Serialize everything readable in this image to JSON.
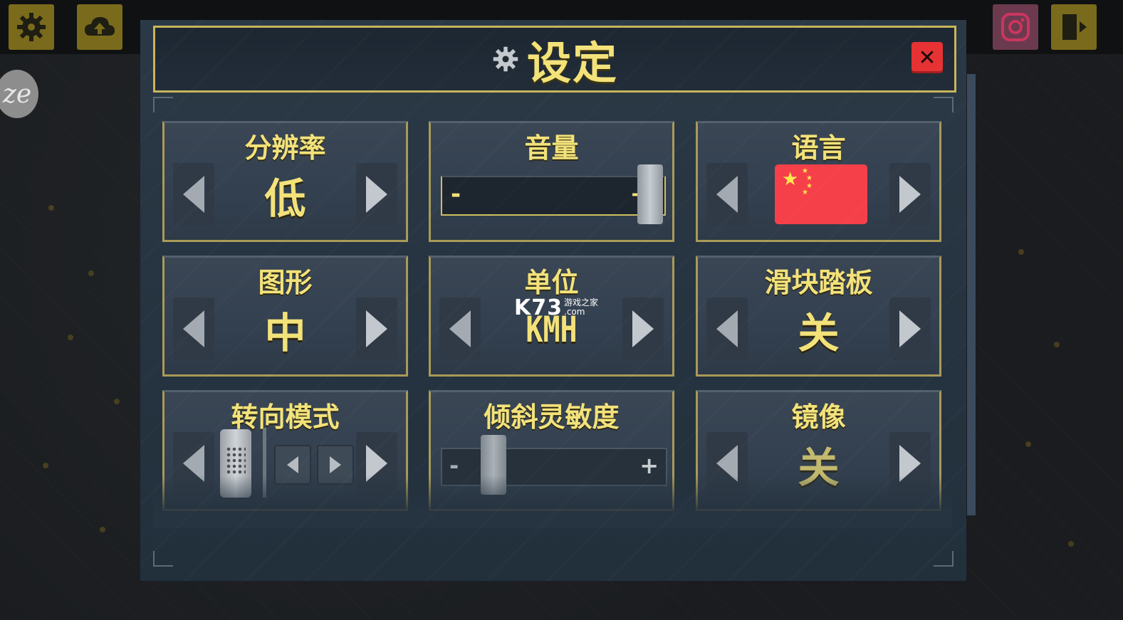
{
  "modal": {
    "title": "设定",
    "close_icon": "close-icon"
  },
  "colors": {
    "accent": "#f3e27a",
    "panel_border": "#a99a58",
    "close_red": "#e63233",
    "flag_red": "#f5404a"
  },
  "settings": {
    "resolution": {
      "label": "分辨率",
      "value": "低"
    },
    "volume": {
      "label": "音量",
      "minus": "-",
      "plus": "+",
      "level": 1.0
    },
    "language": {
      "label": "语言",
      "flag": "china-flag-icon"
    },
    "graphics": {
      "label": "图形",
      "value": "中"
    },
    "units": {
      "label": "单位",
      "value": "KMH"
    },
    "slider_pedal": {
      "label": "滑块踏板",
      "value": "关"
    },
    "steering_mode": {
      "label": "转向模式"
    },
    "tilt_sensitivity": {
      "label": "倾斜灵敏度",
      "minus": "-",
      "plus": "+",
      "level": 0.2
    },
    "mirror": {
      "label": "镜像",
      "value": "关"
    }
  },
  "watermark": {
    "main": "K73",
    "sub1": "游戏之家",
    "sub2": ".com"
  },
  "side_logo": "ze"
}
